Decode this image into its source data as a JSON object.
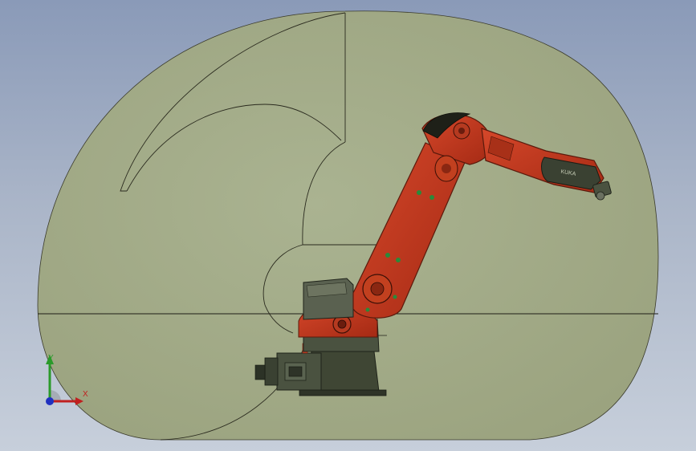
{
  "viewport": {
    "background_top": "#8a9ab8",
    "background_bottom": "#c7cfdb",
    "envelope_fill": "#a6ad8a",
    "robot_color": "#c0341b",
    "base_color": "#3f4634"
  },
  "triad": {
    "x_label": "X",
    "y_label": "Y",
    "x_color": "#c02020",
    "y_color": "#2a9a2a",
    "z_color": "#2030c0"
  },
  "robot": {
    "brand_text": "KUKA"
  }
}
